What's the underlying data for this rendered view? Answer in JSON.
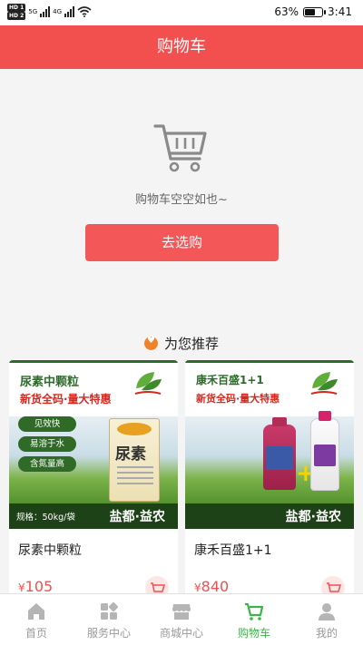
{
  "status_bar": {
    "sim1": "HD 1",
    "sim2": "HD 2",
    "net1": "5G",
    "net2": "4G",
    "battery": "63%",
    "battery_level": 0.63,
    "time": "3:41"
  },
  "header": {
    "title": "购物车"
  },
  "empty_state": {
    "icon": "shopping-cart-icon",
    "message": "购物车空空如也~",
    "button_label": "去选购"
  },
  "recommend": {
    "title": "为您推荐",
    "products": [
      {
        "name": "尿素中颗粒",
        "price_symbol": "¥",
        "price": "105",
        "image": {
          "title": "尿素中颗粒",
          "subtitle": "新货全码·量大特惠",
          "features": [
            "见效快",
            "易溶于水",
            "含氮量高"
          ],
          "spec": "规格：50kg/袋",
          "brand": "盐都·益农",
          "package_text": "尿素"
        }
      },
      {
        "name": "康禾百盛1+1",
        "price_symbol": "¥",
        "price": "840",
        "image": {
          "title": "康禾百盛1+1",
          "subtitle": "新货全码·量大特惠",
          "brand": "盐都·益农"
        }
      }
    ]
  },
  "tabbar": {
    "items": [
      {
        "label": "首页",
        "icon": "home-icon",
        "active": false
      },
      {
        "label": "服务中心",
        "icon": "grid-icon",
        "active": false
      },
      {
        "label": "商城中心",
        "icon": "store-icon",
        "active": false
      },
      {
        "label": "购物车",
        "icon": "cart-icon",
        "active": true
      },
      {
        "label": "我的",
        "icon": "user-icon",
        "active": false
      }
    ]
  },
  "colors": {
    "brand_red": "#f24f4f",
    "active_green": "#3bb34a"
  }
}
